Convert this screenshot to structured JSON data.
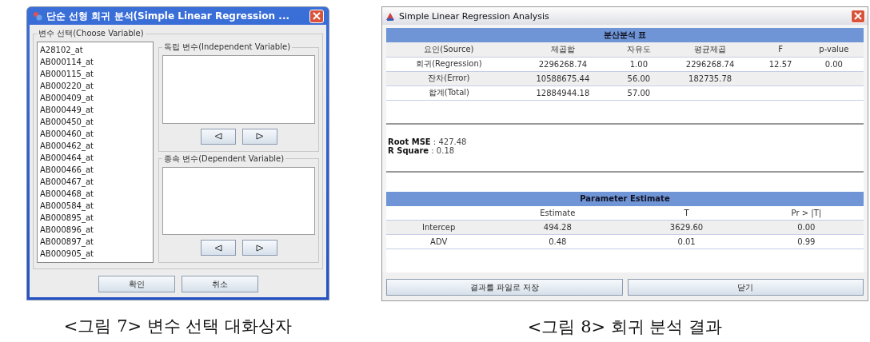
{
  "dialog": {
    "title": "단순 선형 회귀 분석(Simple Linear Regression ...",
    "group_label": "변수 선택(Choose Variable)",
    "variables": [
      "A28102_at",
      "AB000114_at",
      "AB000115_at",
      "AB000220_at",
      "AB000409_at",
      "AB000449_at",
      "AB000450_at",
      "AB000460_at",
      "AB000462_at",
      "AB000464_at",
      "AB000466_at",
      "AB000467_at",
      "AB000468_at",
      "AB000584_at",
      "AB000895_at",
      "AB000896_at",
      "AB000897_at",
      "AB000905_at"
    ],
    "boxes": [
      {
        "label": "독립 변수(Independent Variable)"
      },
      {
        "label": "종속 변수(Dependent Variable)"
      }
    ],
    "buttons": [
      "확인",
      "취소"
    ]
  },
  "results": {
    "title": "Simple Linear Regression Analysis",
    "anova": {
      "title": "분산분석 표",
      "columns": [
        "요인(Source)",
        "제곱합",
        "자유도",
        "평균제곱",
        "F",
        "p-value"
      ],
      "rows": [
        [
          "회귀(Regression)",
          "2296268.74",
          "1.00",
          "2296268.74",
          "12.57",
          "0.00"
        ],
        [
          "잔차(Error)",
          "10588675.44",
          "56.00",
          "182735.78",
          "",
          ""
        ],
        [
          "합계(Total)",
          "12884944.18",
          "57.00",
          "",
          "",
          ""
        ]
      ]
    },
    "stats": [
      "**Root MSE** : 427.48",
      "**R Square** : 0.18"
    ],
    "params": {
      "title": "Parameter Estimate",
      "columns": [
        "",
        "Estimate",
        "T",
        "Pr > |T|"
      ],
      "rows": [
        [
          "Intercep",
          "494.28",
          "3629.60",
          "0.00"
        ],
        [
          "ADV",
          "0.48",
          "0.01",
          "0.99"
        ]
      ]
    },
    "buttons": [
      "결과를 파일로 저장",
      "닫기"
    ]
  },
  "captions": [
    "<그림 7> 변수 선택 대화상자",
    "<그림 8> 회귀 분석 결과"
  ]
}
